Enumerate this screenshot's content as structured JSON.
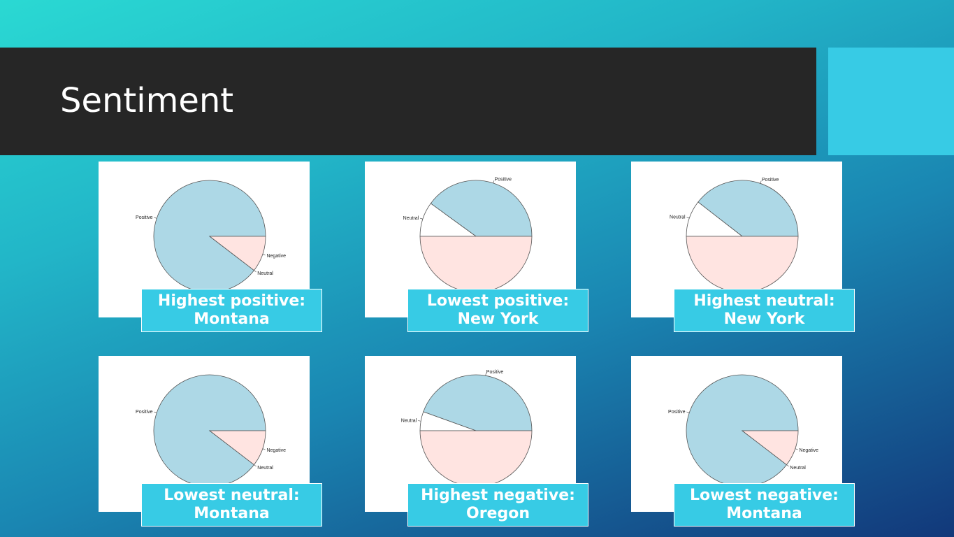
{
  "slide": {
    "title": "Sentiment"
  },
  "colors": {
    "positive": "#add8e6",
    "neutral": "#ffffff",
    "negative": "#ffe4e1",
    "caption_bg": "#37cbe5",
    "title_bar": "#262626"
  },
  "chart_data": [
    {
      "type": "pie",
      "caption": "Highest positive: Montana",
      "categories": [
        "Positive",
        "Neutral",
        "Negative"
      ],
      "values": [
        0.896,
        0.0,
        0.104
      ]
    },
    {
      "type": "pie",
      "caption": "Lowest positive: New York",
      "categories": [
        "Positive",
        "Neutral",
        "Negative"
      ],
      "values": [
        0.4,
        0.1,
        0.5
      ]
    },
    {
      "type": "pie",
      "caption": "Highest neutral: New York",
      "categories": [
        "Positive",
        "Neutral",
        "Negative"
      ],
      "values": [
        0.395,
        0.105,
        0.5
      ]
    },
    {
      "type": "pie",
      "caption": "Lowest neutral: Montana",
      "categories": [
        "Positive",
        "Neutral",
        "Negative"
      ],
      "values": [
        0.896,
        0.0,
        0.104
      ]
    },
    {
      "type": "pie",
      "caption": "Highest negative: Oregon",
      "categories": [
        "Positive",
        "Neutral",
        "Negative"
      ],
      "values": [
        0.445,
        0.055,
        0.5
      ]
    },
    {
      "type": "pie",
      "caption": "Lowest negative: Montana",
      "categories": [
        "Positive",
        "Neutral",
        "Negative"
      ],
      "values": [
        0.896,
        0.0,
        0.104
      ]
    }
  ]
}
